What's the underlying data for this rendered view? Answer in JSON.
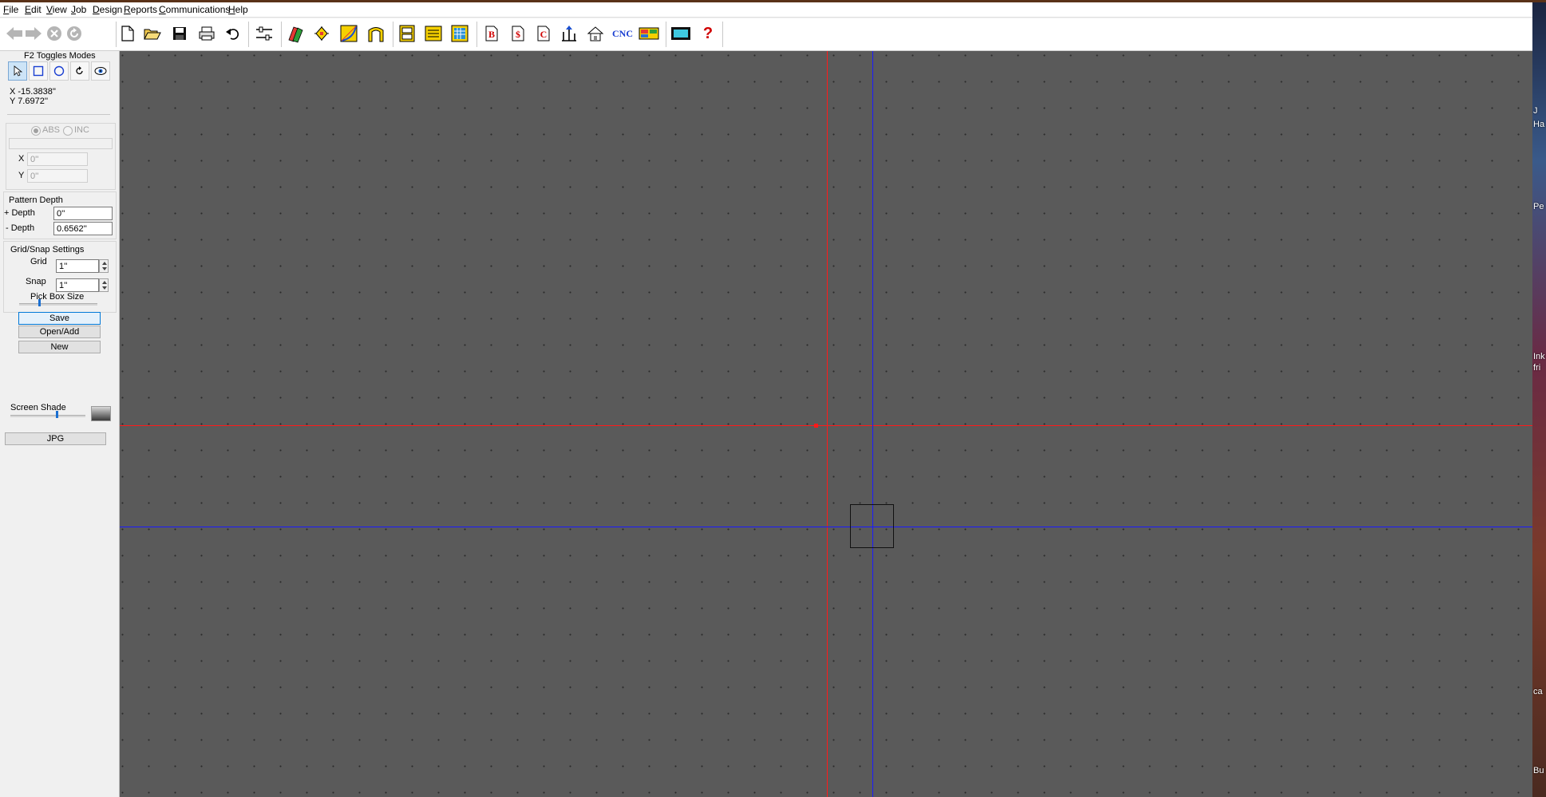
{
  "menu": [
    {
      "label": "File",
      "key": "F",
      "rest": "ile"
    },
    {
      "label": "Edit",
      "key": "E",
      "rest": "dit"
    },
    {
      "label": "View",
      "key": "V",
      "rest": "iew"
    },
    {
      "label": "Job",
      "key": "J",
      "rest": "ob"
    },
    {
      "label": "Design",
      "key": "D",
      "rest": "esign"
    },
    {
      "label": "Reports",
      "key": "R",
      "rest": "eports"
    },
    {
      "label": "Communications",
      "key": "C",
      "rest": "ommunications"
    },
    {
      "label": "Help",
      "key": "H",
      "rest": "elp"
    }
  ],
  "toolbar": {
    "cnc_label": "CNC",
    "help_glyph": "?",
    "report_b": "B",
    "report_dollar": "$",
    "report_c": "C"
  },
  "left_panel": {
    "modes_title": "F2 Toggles Modes",
    "cursor_x": "X -15.3838''",
    "cursor_y": "Y 7.6972''",
    "abs_label": "ABS",
    "inc_label": "INC",
    "x_label": "X",
    "y_label": "Y",
    "x_value": "0''",
    "y_value": "0''",
    "pattern_depth_title": "Pattern Depth",
    "plus_depth_label": "+ Depth",
    "minus_depth_label": "- Depth",
    "plus_depth_value": "0''",
    "minus_depth_value": "0.6562''",
    "grid_snap_title": "Grid/Snap Settings",
    "grid_label": "Grid",
    "grid_value": "1''",
    "snap_label": "Snap",
    "snap_value": "1''",
    "pick_box_label": "Pick Box Size",
    "save_label": "Save",
    "open_add_label": "Open/Add",
    "new_label": "New",
    "screen_shade_label": "Screen Shade",
    "jpg_label": "JPG"
  },
  "desktop_labels": [
    "J",
    "Ha",
    "Pe",
    "Ink",
    "fri",
    "ca",
    "Bu"
  ],
  "colors": {
    "canvas": "#5a5a5a",
    "origin_axis": "#ff0000",
    "cursor_axis": "#0000ff",
    "active_blue": "#0078d7"
  }
}
